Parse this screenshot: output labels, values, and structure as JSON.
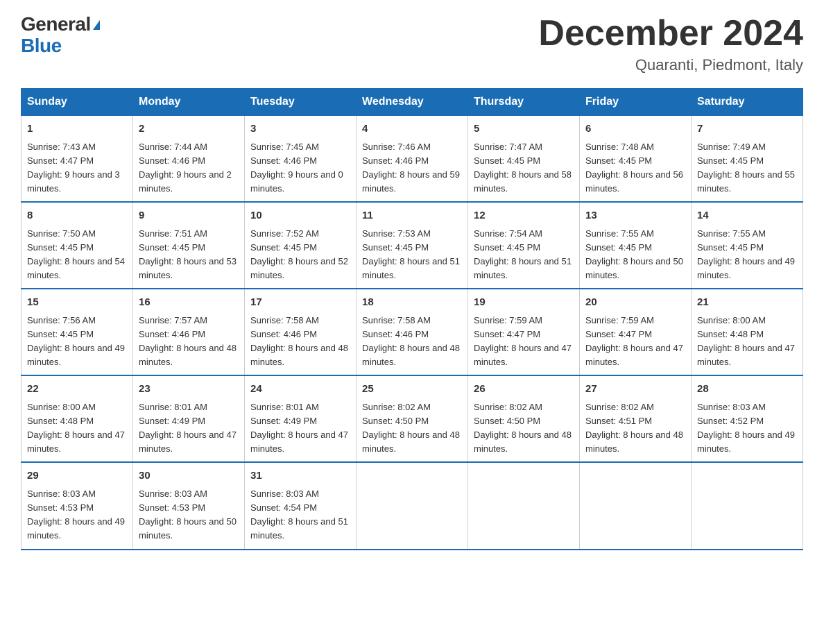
{
  "logo": {
    "general": "General",
    "blue": "Blue"
  },
  "header": {
    "month": "December 2024",
    "location": "Quaranti, Piedmont, Italy"
  },
  "weekdays": [
    "Sunday",
    "Monday",
    "Tuesday",
    "Wednesday",
    "Thursday",
    "Friday",
    "Saturday"
  ],
  "weeks": [
    [
      {
        "day": "1",
        "sunrise": "7:43 AM",
        "sunset": "4:47 PM",
        "daylight": "9 hours and 3 minutes."
      },
      {
        "day": "2",
        "sunrise": "7:44 AM",
        "sunset": "4:46 PM",
        "daylight": "9 hours and 2 minutes."
      },
      {
        "day": "3",
        "sunrise": "7:45 AM",
        "sunset": "4:46 PM",
        "daylight": "9 hours and 0 minutes."
      },
      {
        "day": "4",
        "sunrise": "7:46 AM",
        "sunset": "4:46 PM",
        "daylight": "8 hours and 59 minutes."
      },
      {
        "day": "5",
        "sunrise": "7:47 AM",
        "sunset": "4:45 PM",
        "daylight": "8 hours and 58 minutes."
      },
      {
        "day": "6",
        "sunrise": "7:48 AM",
        "sunset": "4:45 PM",
        "daylight": "8 hours and 56 minutes."
      },
      {
        "day": "7",
        "sunrise": "7:49 AM",
        "sunset": "4:45 PM",
        "daylight": "8 hours and 55 minutes."
      }
    ],
    [
      {
        "day": "8",
        "sunrise": "7:50 AM",
        "sunset": "4:45 PM",
        "daylight": "8 hours and 54 minutes."
      },
      {
        "day": "9",
        "sunrise": "7:51 AM",
        "sunset": "4:45 PM",
        "daylight": "8 hours and 53 minutes."
      },
      {
        "day": "10",
        "sunrise": "7:52 AM",
        "sunset": "4:45 PM",
        "daylight": "8 hours and 52 minutes."
      },
      {
        "day": "11",
        "sunrise": "7:53 AM",
        "sunset": "4:45 PM",
        "daylight": "8 hours and 51 minutes."
      },
      {
        "day": "12",
        "sunrise": "7:54 AM",
        "sunset": "4:45 PM",
        "daylight": "8 hours and 51 minutes."
      },
      {
        "day": "13",
        "sunrise": "7:55 AM",
        "sunset": "4:45 PM",
        "daylight": "8 hours and 50 minutes."
      },
      {
        "day": "14",
        "sunrise": "7:55 AM",
        "sunset": "4:45 PM",
        "daylight": "8 hours and 49 minutes."
      }
    ],
    [
      {
        "day": "15",
        "sunrise": "7:56 AM",
        "sunset": "4:45 PM",
        "daylight": "8 hours and 49 minutes."
      },
      {
        "day": "16",
        "sunrise": "7:57 AM",
        "sunset": "4:46 PM",
        "daylight": "8 hours and 48 minutes."
      },
      {
        "day": "17",
        "sunrise": "7:58 AM",
        "sunset": "4:46 PM",
        "daylight": "8 hours and 48 minutes."
      },
      {
        "day": "18",
        "sunrise": "7:58 AM",
        "sunset": "4:46 PM",
        "daylight": "8 hours and 48 minutes."
      },
      {
        "day": "19",
        "sunrise": "7:59 AM",
        "sunset": "4:47 PM",
        "daylight": "8 hours and 47 minutes."
      },
      {
        "day": "20",
        "sunrise": "7:59 AM",
        "sunset": "4:47 PM",
        "daylight": "8 hours and 47 minutes."
      },
      {
        "day": "21",
        "sunrise": "8:00 AM",
        "sunset": "4:48 PM",
        "daylight": "8 hours and 47 minutes."
      }
    ],
    [
      {
        "day": "22",
        "sunrise": "8:00 AM",
        "sunset": "4:48 PM",
        "daylight": "8 hours and 47 minutes."
      },
      {
        "day": "23",
        "sunrise": "8:01 AM",
        "sunset": "4:49 PM",
        "daylight": "8 hours and 47 minutes."
      },
      {
        "day": "24",
        "sunrise": "8:01 AM",
        "sunset": "4:49 PM",
        "daylight": "8 hours and 47 minutes."
      },
      {
        "day": "25",
        "sunrise": "8:02 AM",
        "sunset": "4:50 PM",
        "daylight": "8 hours and 48 minutes."
      },
      {
        "day": "26",
        "sunrise": "8:02 AM",
        "sunset": "4:50 PM",
        "daylight": "8 hours and 48 minutes."
      },
      {
        "day": "27",
        "sunrise": "8:02 AM",
        "sunset": "4:51 PM",
        "daylight": "8 hours and 48 minutes."
      },
      {
        "day": "28",
        "sunrise": "8:03 AM",
        "sunset": "4:52 PM",
        "daylight": "8 hours and 49 minutes."
      }
    ],
    [
      {
        "day": "29",
        "sunrise": "8:03 AM",
        "sunset": "4:53 PM",
        "daylight": "8 hours and 49 minutes."
      },
      {
        "day": "30",
        "sunrise": "8:03 AM",
        "sunset": "4:53 PM",
        "daylight": "8 hours and 50 minutes."
      },
      {
        "day": "31",
        "sunrise": "8:03 AM",
        "sunset": "4:54 PM",
        "daylight": "8 hours and 51 minutes."
      },
      null,
      null,
      null,
      null
    ]
  ]
}
